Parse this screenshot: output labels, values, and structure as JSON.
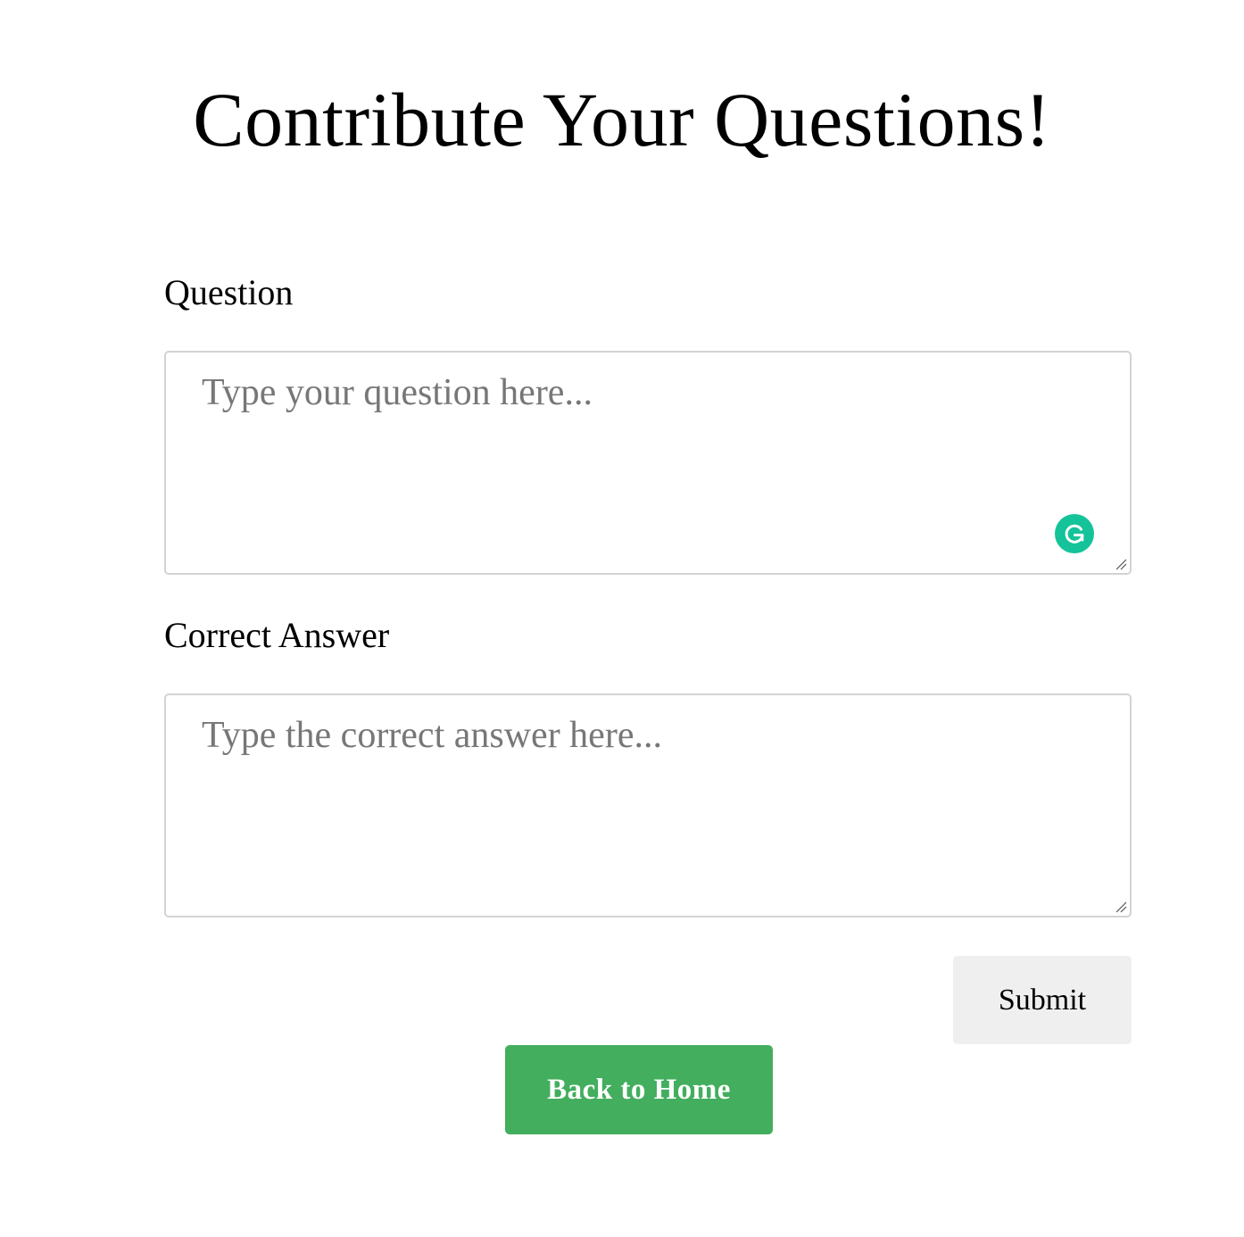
{
  "page": {
    "title": "Contribute Your Questions!"
  },
  "form": {
    "question": {
      "label": "Question",
      "placeholder": "Type your question here...",
      "value": ""
    },
    "answer": {
      "label": "Correct Answer",
      "placeholder": "Type the correct answer here...",
      "value": ""
    },
    "submit_label": "Submit"
  },
  "navigation": {
    "home_label": "Back to Home"
  },
  "icons": {
    "grammarly": "grammarly-icon",
    "resize": "resize-handle-icon"
  },
  "colors": {
    "home_button": "#42ae5e",
    "submit_button": "#efefef",
    "grammarly": "#15c39a",
    "placeholder_text": "#777777",
    "field_border": "#d3d3d3"
  }
}
